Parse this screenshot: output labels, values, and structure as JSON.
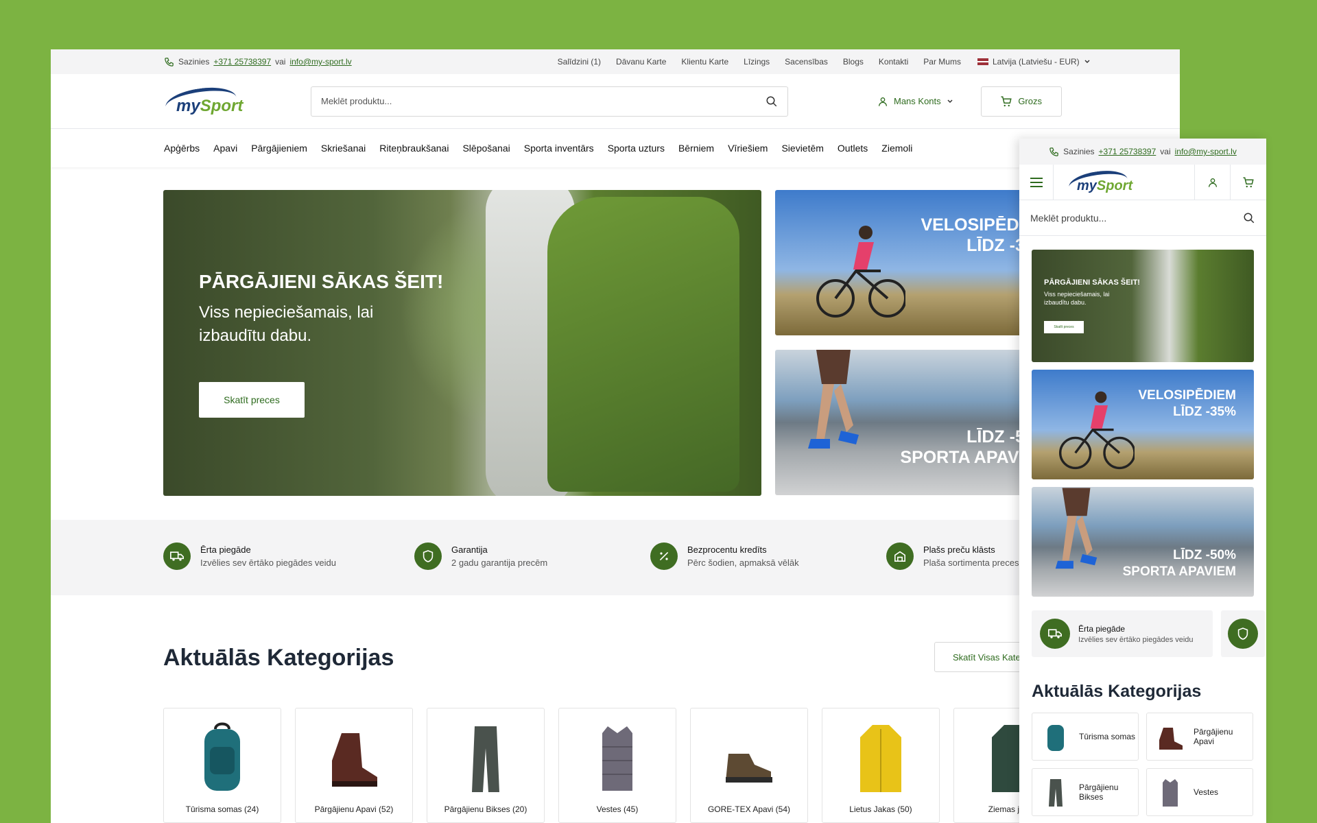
{
  "topbar": {
    "contact_prefix": "Sazinies",
    "phone": "+371 25738397",
    "or": "vai",
    "email": "info@my-sport.lv",
    "links": [
      "Salīdzini (1)",
      "Dāvanu Karte",
      "Klientu Karte",
      "Līzings",
      "Sacensības",
      "Blogs",
      "Kontakti",
      "Par Mums"
    ],
    "language": "Latvija (Latviešu - EUR)"
  },
  "header": {
    "logo_text_1": "my",
    "logo_text_2": "Sport",
    "search_placeholder": "Meklēt produktu...",
    "account_label": "Mans Konts",
    "cart_label": "Grozs"
  },
  "nav": [
    "Apģērbs",
    "Apavi",
    "Pārgājieniem",
    "Skriešanai",
    "Riteņbraukšanai",
    "Slēpošanai",
    "Sporta inventārs",
    "Sporta uzturs",
    "Bērniem",
    "Vīriešiem",
    "Sievietēm",
    "Outlets",
    "Ziemoli"
  ],
  "hero": {
    "title": "PĀRGĀJIENI SĀKAS ŠEIT!",
    "subtitle": "Viss nepieciešamais, lai izbaudītu dabu.",
    "button": "Skatīt preces"
  },
  "promos": [
    {
      "line1": "VELOSIPĒDIEM",
      "line2": "LĪDZ -35%"
    },
    {
      "line1": "LĪDZ -50%",
      "line2": "SPORTA APAVIEM"
    }
  ],
  "benefits": [
    {
      "title": "Ērta piegāde",
      "subtitle": "Izvēlies sev ērtāko piegādes veidu",
      "icon": "truck-icon"
    },
    {
      "title": "Garantija",
      "subtitle": "2 gadu garantija precēm",
      "icon": "shield-icon"
    },
    {
      "title": "Bezprocentu kredīts",
      "subtitle": "Pērc šodien, apmaksā vēlāk",
      "icon": "percent-icon"
    },
    {
      "title": "Plašs preču klāsts",
      "subtitle": "Plaša sortimenta preces",
      "icon": "warehouse-icon"
    }
  ],
  "categories": {
    "title": "Aktuālās Kategorijas",
    "see_all": "Skatīt Visas Kategorijas",
    "items": [
      {
        "label": "Tūrisma somas (24)",
        "color": "#1f6f7a"
      },
      {
        "label": "Pārgājienu Apavi (52)",
        "color": "#5a2a22"
      },
      {
        "label": "Pārgājienu Bikses (20)",
        "color": "#4a524d"
      },
      {
        "label": "Vestes (45)",
        "color": "#6e6a78"
      },
      {
        "label": "GORE-TEX Apavi (54)",
        "color": "#5d4a33"
      },
      {
        "label": "Lietus Jakas (50)",
        "color": "#e8c318"
      },
      {
        "label": "Ziemas jakas",
        "color": "#2f4a3e"
      }
    ]
  },
  "mobile": {
    "contact_prefix": "Sazinies",
    "phone": "+371 25738397",
    "or": "vai",
    "email": "info@my-sport.lv",
    "search_placeholder": "Meklēt produktu...",
    "banner_title": "PĀRGĀJIENI SĀKAS ŠEIT!",
    "banner_sub": "Viss nepieciešamais, lai izbaudītu dabu.",
    "banner_btn": "Skatīt preces",
    "promo1_line1": "VELOSIPĒDIEM",
    "promo1_line2": "LĪDZ -35%",
    "promo2_line1": "LĪDZ -50%",
    "promo2_line2": "SPORTA APAVIEM",
    "benefit_title": "Ērta piegāde",
    "benefit_sub": "Izvēlies sev ērtāko piegādes veidu",
    "cat_title": "Aktuālās Kategorijas",
    "cats": [
      {
        "label": "Tūrisma somas",
        "color": "#1f6f7a"
      },
      {
        "label": "Pārgājienu Apavi",
        "color": "#5a2a22"
      },
      {
        "label": "Pārgājienu Bikses",
        "color": "#4a524d"
      },
      {
        "label": "Vestes",
        "color": "#6e6a78"
      }
    ]
  },
  "colors": {
    "brand_green": "#3f6d22",
    "background": "#7cb342",
    "link": "#2e6b1e"
  }
}
